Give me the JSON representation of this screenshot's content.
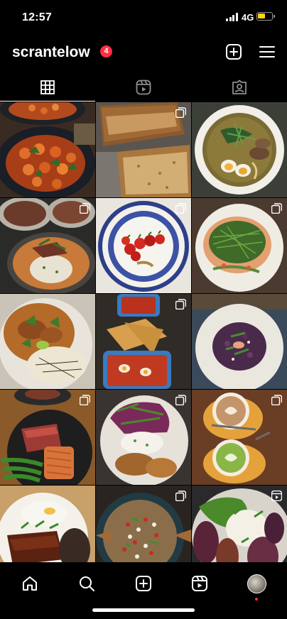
{
  "status_bar": {
    "time": "12:57",
    "network": "4G",
    "battery_level": 0.55,
    "battery_color": "#ffd60a"
  },
  "header": {
    "username": "scrantelow",
    "notification_count": "4",
    "badge_color": "#ff3040",
    "icons": [
      "new-post-icon",
      "menu-icon"
    ]
  },
  "tabs": [
    {
      "icon": "grid-icon",
      "active": true
    },
    {
      "icon": "reels-icon",
      "active": false
    },
    {
      "icon": "tagged-icon",
      "active": false
    }
  ],
  "grid_posts": [
    {
      "name": "gnocchi-bowl",
      "type": "single"
    },
    {
      "name": "loaf-cake-slices",
      "type": "carousel"
    },
    {
      "name": "ramen-bowl",
      "type": "single"
    },
    {
      "name": "beef-curry-rice",
      "type": "carousel"
    },
    {
      "name": "tomatoes-blue-plate",
      "type": "carousel"
    },
    {
      "name": "dill-salad-plate",
      "type": "carousel"
    },
    {
      "name": "curry-with-lime",
      "type": "single"
    },
    {
      "name": "tortilla-chips-bake",
      "type": "carousel"
    },
    {
      "name": "red-cabbage-salad",
      "type": "single"
    },
    {
      "name": "steak-broccolini",
      "type": "carousel"
    },
    {
      "name": "chicken-salad-plate",
      "type": "carousel"
    },
    {
      "name": "latte-art-cups",
      "type": "carousel"
    },
    {
      "name": "glazed-pork-bowl",
      "type": "single"
    },
    {
      "name": "grain-salad-bowl",
      "type": "carousel"
    },
    {
      "name": "aubergine-reel",
      "type": "reel"
    }
  ],
  "bottom_nav": {
    "items": [
      "home-icon",
      "search-icon",
      "create-icon",
      "reels-icon",
      "profile-avatar"
    ],
    "active_indicator_color": "#ff3040"
  }
}
